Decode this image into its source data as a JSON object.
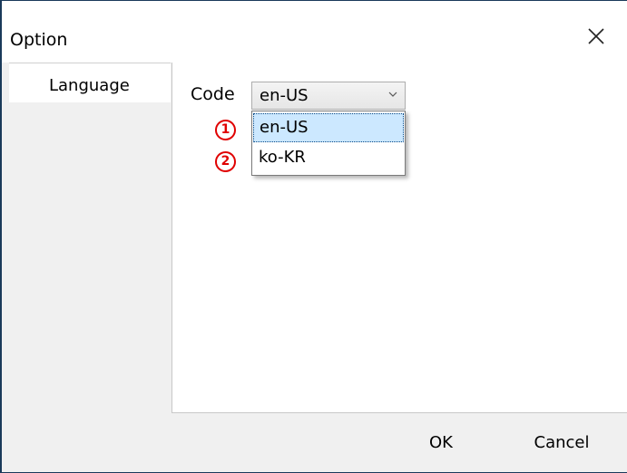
{
  "window": {
    "title": "Option",
    "close_icon": "close-icon"
  },
  "sidebar": {
    "tabs": [
      {
        "label": "Language",
        "selected": true
      }
    ]
  },
  "language": {
    "code_label": "Code",
    "selected_value": "en-US",
    "options": [
      {
        "marker": "1",
        "label": "en-US",
        "highlighted": true
      },
      {
        "marker": "2",
        "label": "ko-KR",
        "highlighted": false
      }
    ]
  },
  "footer": {
    "ok_label": "OK",
    "cancel_label": "Cancel"
  },
  "colors": {
    "selection_bg": "#cce8ff",
    "marker": "#e00000",
    "window_border": "#1a3a5a"
  }
}
